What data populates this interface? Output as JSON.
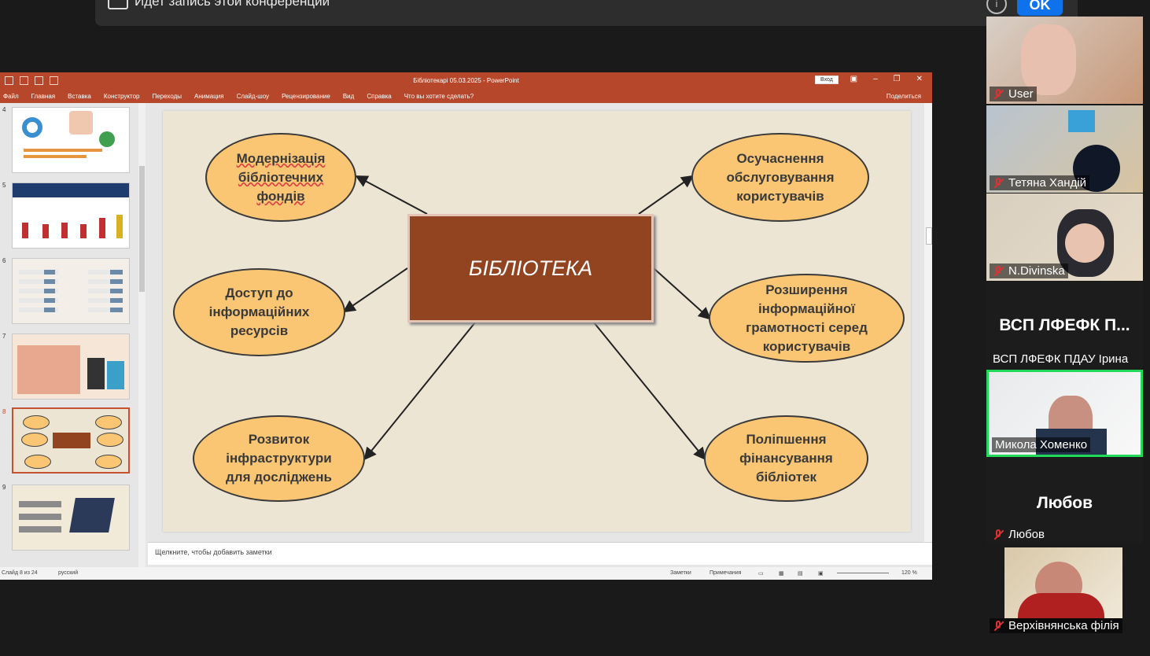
{
  "banner": {
    "text": "Идет запись этой конференции",
    "info": "i",
    "ok": "OK"
  },
  "ppt": {
    "title": "Бібліотекарі 05.03.2025  -  PowerPoint",
    "login": "Вход",
    "tabs": [
      "Файл",
      "Главная",
      "Вставка",
      "Конструктор",
      "Переходы",
      "Анимация",
      "Слайд-шоу",
      "Рецензирование",
      "Вид",
      "Справка",
      "Что вы хотите сделать?"
    ],
    "share": "Поделиться",
    "notes_placeholder": "Щелкните, чтобы добавить заметки",
    "status": {
      "slide": "Слайд 8 из 24",
      "lang": "русский",
      "notes": "Заметки",
      "comments": "Примечания",
      "zoom": "120 %"
    },
    "thumb_numbers": [
      "4",
      "5",
      "6",
      "7",
      "8",
      "9"
    ]
  },
  "slide": {
    "center": "БІБЛІОТЕКА",
    "nodes": {
      "tl": "Модернізація\nбібліотечних\nфондів",
      "tr": "Осучаснення\nобслуговування\nкористувачів",
      "ml": "Доступ до\nінформаційних\nресурсів",
      "mr": "Розширення\nінформаційної\nграмотності серед\nкористувачів",
      "bl": "Розвиток\nінфраструктури\nдля досліджень",
      "br": "Поліпшення\nфінансування\nбібліотек"
    }
  },
  "participants": [
    {
      "name": "User"
    },
    {
      "name": "Тетяна Хандій"
    },
    {
      "name": "N.Divinska"
    },
    {
      "name": "ВСП ЛФЕФК ПДАУ Ірина",
      "big": "ВСП ЛФЕФК П..."
    },
    {
      "name": "Микола Хоменко"
    },
    {
      "name": "Любов",
      "big": "Любов"
    },
    {
      "name": "Верхівнянська філія"
    }
  ]
}
